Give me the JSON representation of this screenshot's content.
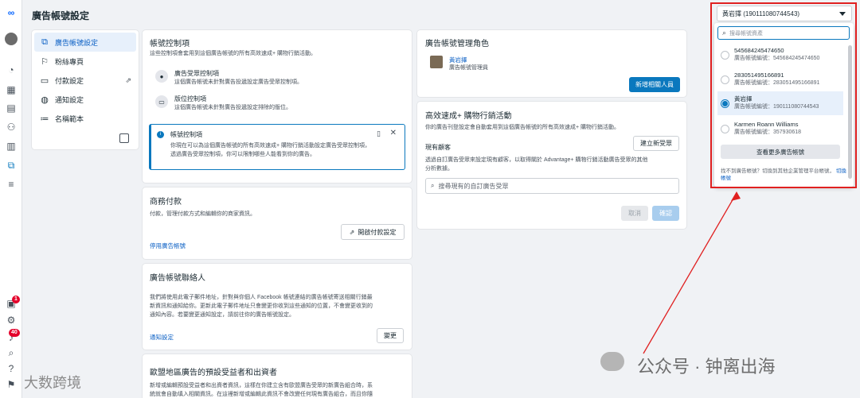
{
  "rail": {
    "badges": {
      "alerts": "1",
      "notifications": "40"
    }
  },
  "header": {
    "title": "廣告帳號設定"
  },
  "subnav": {
    "items": [
      {
        "label": "廣告帳號設定",
        "icon": "ad-account-icon"
      },
      {
        "label": "粉絲專頁",
        "icon": "flag-icon"
      },
      {
        "label": "付款設定",
        "icon": "credit-card-icon"
      },
      {
        "label": "通知設定",
        "icon": "globe-icon"
      },
      {
        "label": "名稱範本",
        "icon": "naming-template-icon"
      }
    ]
  },
  "controls": {
    "title": "帳號控制項",
    "desc": "這些控制項會套用到這個廣告帳號的所有高效速成+ 購物行銷活動。",
    "items": [
      {
        "title": "廣告受眾控制項",
        "desc": "這個廣告帳號未針對廣告投遞設定廣告受眾控制項。"
      },
      {
        "title": "版位控制項",
        "desc": "這個廣告帳號未針對廣告投遞設定排除的版位。"
      }
    ],
    "info": {
      "title": "帳號控制項",
      "line1": "你現在可以為這個廣告帳號的所有高效速成+ 購物行銷活動設定廣告受眾控制項，",
      "line2": "透過廣告受眾控制項，你可以限制哪些人能看到你的廣告。"
    }
  },
  "payments": {
    "title": "商務付款",
    "desc": "付款，管理付款方式和編輯你的商家資訊。",
    "open_button": "開啟付款設定",
    "link": "停用廣告帳號"
  },
  "contact": {
    "title": "廣告帳號聯絡人",
    "line1": "我們將使用此電子郵件地址，針對與你個人 Facebook 帳號連結的廣告帳號寄送相關行銷最",
    "line2": "新資訊和通知給你。更新此電子郵件地址只會變更你收到這些通知的位置，不會變更收到的",
    "line3": "通知內容。若要變更通知設定，請前往你的廣告帳號設定。",
    "link": "通知設定",
    "edit_button": "變更"
  },
  "eu": {
    "title": "歐盟地區廣告的預設受益者和出資者",
    "line1": "新增或編輯預設受益者和出資者資訊，這樣在你建立含有歐盟廣告受眾的新廣告組合時，系",
    "line2": "統就會自動填入相關資訊。在這裡新增或編輯此資訊不會改變任何現有廣告組合，而且你隨"
  },
  "roles": {
    "title": "廣告帳號管理角色",
    "person_name": "黃岩擇",
    "person_role": "廣告帳號管理員",
    "add_button": "新增相關人員"
  },
  "advantage": {
    "title": "高效速成+ 購物行銷活動",
    "desc": "你的廣告刊登設定會自動套用到這個廣告帳號的所有高效速成+ 購物行銷活動。",
    "existing_label": "現有顧客",
    "new_audience_button": "建立新受眾",
    "line1": "透過自訂廣告受眾來設定現有顧客，以取得關於 Advantage+ 購物行銷活動廣告受眾的其他",
    "line2": "分析數據。",
    "search_placeholder": "搜尋現有的自訂廣告受眾",
    "cancel": "取消",
    "confirm": "確認"
  },
  "account_dropdown": {
    "selected": "黃岩擇 (190111080744543)",
    "search_placeholder": "搜尋帳號資產",
    "options": [
      {
        "name": "545684245474650",
        "id_line": "廣告帳號編號：545684245474650",
        "selected": false
      },
      {
        "name": "283051495166891",
        "id_line": "廣告帳號編號：283051495166891",
        "selected": false
      },
      {
        "name": "黃岩擇",
        "id_line": "廣告帳號編號：190111080744543",
        "selected": true
      },
      {
        "name": "Karmen Roann Williams",
        "id_line": "廣告帳號編號：357930618",
        "selected": false
      }
    ],
    "more_button": "查看更多廣告帳號",
    "footer_text": "找不到廣告帳號？切換到其他企業管理平台帳號，",
    "footer_link": "切換帳號"
  },
  "watermarks": {
    "left": "大数跨境",
    "right": "公众号 · 钟离出海"
  },
  "colors": {
    "accent": "#0a78be",
    "annotation": "#e02020"
  }
}
